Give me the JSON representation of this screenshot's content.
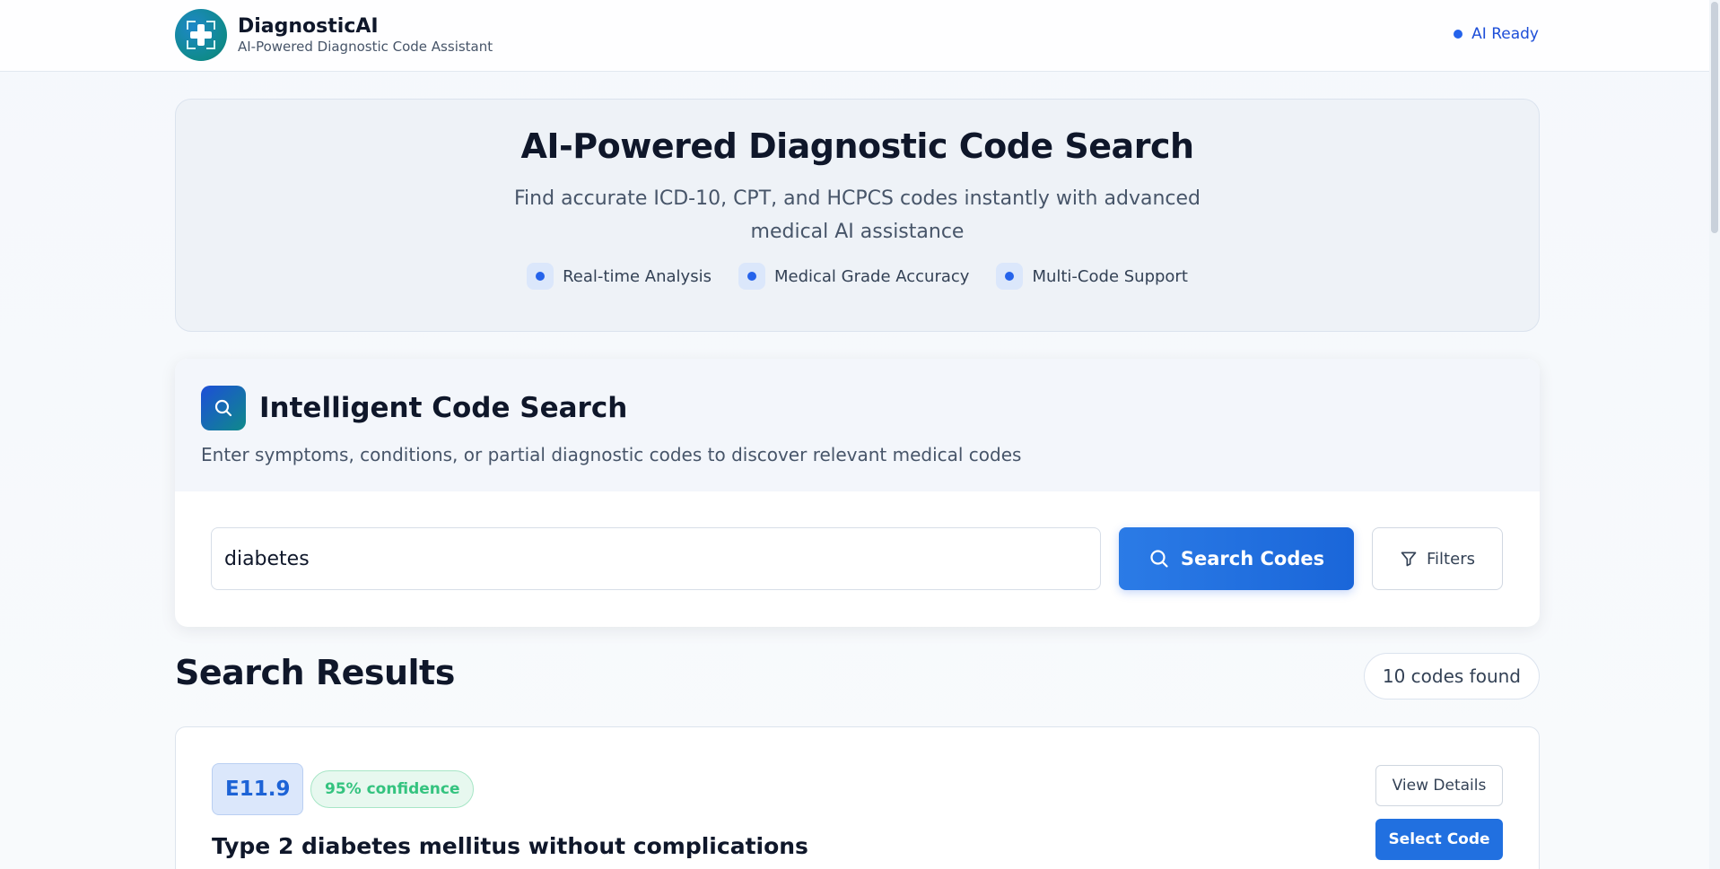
{
  "header": {
    "brand_name": "DiagnosticAI",
    "brand_subtitle": "AI-Powered Diagnostic Code Assistant",
    "logo_icon": "medical-cross-icon",
    "status_text": "AI Ready"
  },
  "hero": {
    "title": "AI-Powered Diagnostic Code Search",
    "subtitle": "Find accurate ICD-10, CPT, and HCPCS codes instantly with advanced medical AI assistance",
    "features": [
      {
        "label": "Real-time Analysis"
      },
      {
        "label": "Medical Grade Accuracy"
      },
      {
        "label": "Multi-Code Support"
      }
    ]
  },
  "search": {
    "title": "Intelligent Code Search",
    "description": "Enter symptoms, conditions, or partial diagnostic codes to discover relevant medical codes",
    "input_value": "diabetes",
    "search_button_label": "Search Codes",
    "filters_button_label": "Filters"
  },
  "results": {
    "title": "Search Results",
    "count_text": "10 codes found",
    "items": [
      {
        "code": "E11.9",
        "confidence": "95% confidence",
        "name": "Type 2 diabetes mellitus without complications",
        "view_label": "View Details",
        "select_label": "Select Code"
      }
    ]
  },
  "colors": {
    "accent": "#2563eb",
    "teal": "#0f8a8a",
    "confidence_green": "#34c37f"
  }
}
